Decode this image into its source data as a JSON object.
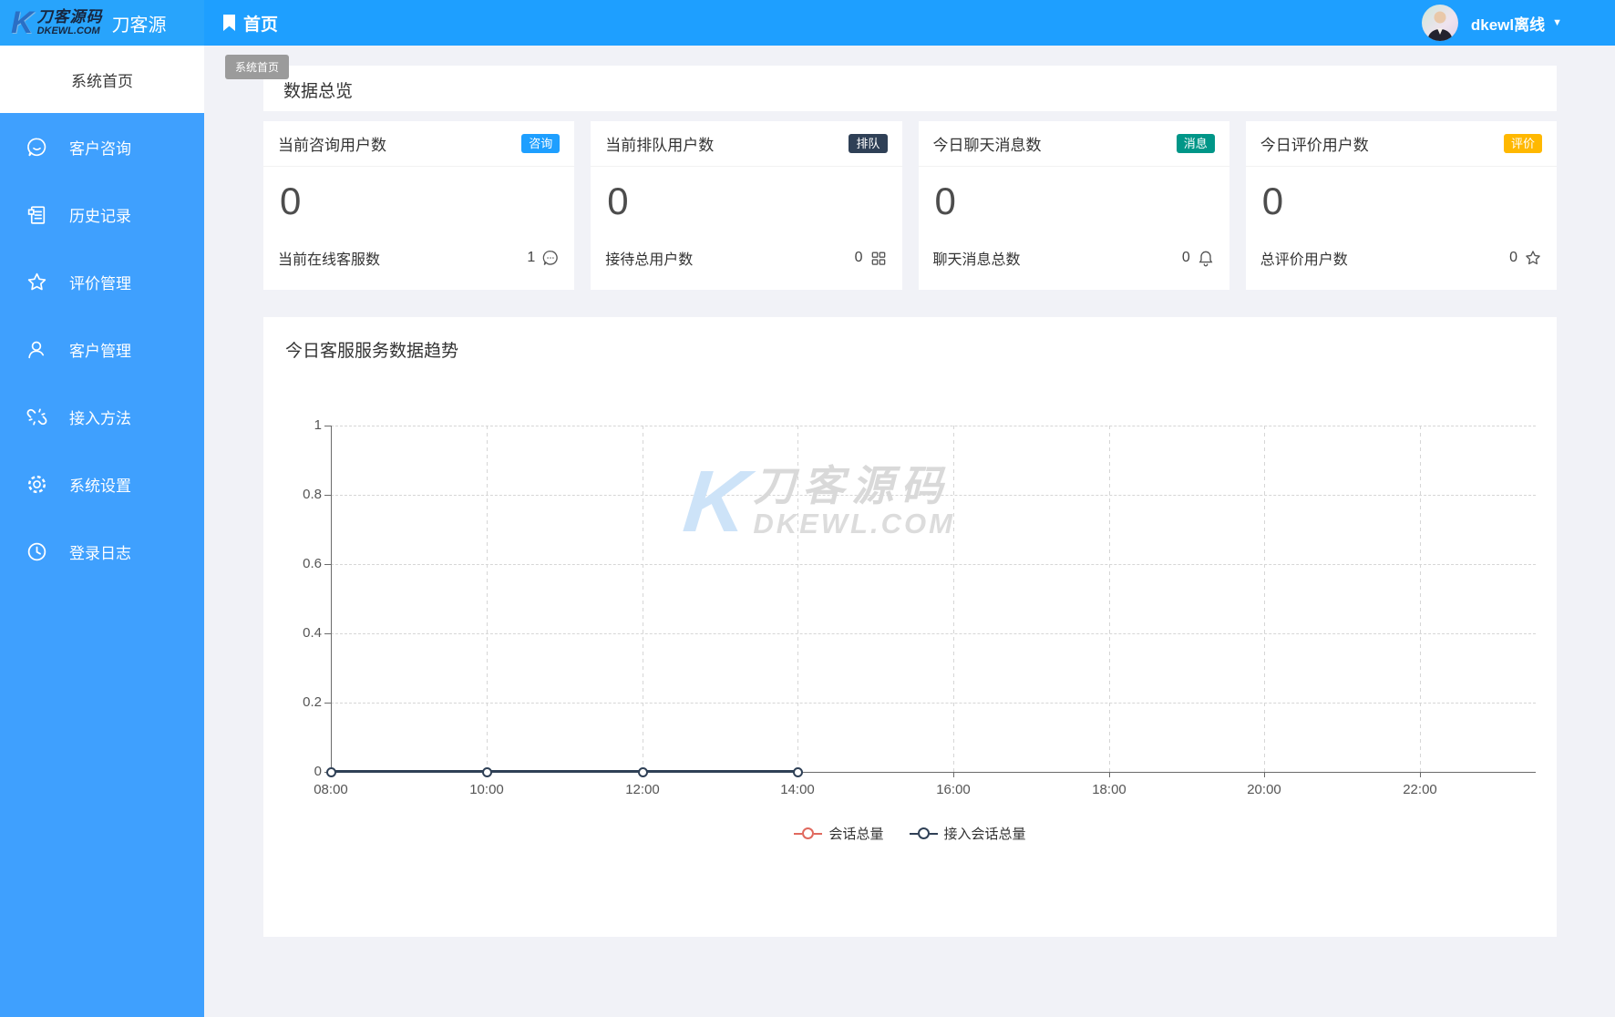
{
  "header": {
    "logo": {
      "k_glyph": "K",
      "brand_cn": "刀客源码",
      "brand_domain": "DKEWL.COM",
      "site_name": "刀客源"
    },
    "nav_home_label": "首页",
    "user": {
      "name_status": "dkewl离线",
      "caret": "▼"
    }
  },
  "tooltip_text": "系统首页",
  "sidebar": {
    "active_item": "系统首页",
    "items": [
      {
        "label": "客户咨询",
        "icon": "chat-smile-icon"
      },
      {
        "label": "历史记录",
        "icon": "history-record-icon"
      },
      {
        "label": "评价管理",
        "icon": "star-icon"
      },
      {
        "label": "客户管理",
        "icon": "user-icon"
      },
      {
        "label": "接入方法",
        "icon": "broken-link-icon"
      },
      {
        "label": "系统设置",
        "icon": "gear-icon"
      },
      {
        "label": "登录日志",
        "icon": "clock-icon"
      }
    ]
  },
  "overview": {
    "title": "数据总览"
  },
  "stat_cards": [
    {
      "title": "当前咨询用户数",
      "badge": "咨询",
      "badge_color": "#1e9fff",
      "value": "0",
      "sub_label": "当前在线客服数",
      "sub_value": "1",
      "sub_icon": "chat-smile-icon"
    },
    {
      "title": "当前排队用户数",
      "badge": "排队",
      "badge_color": "#2f4056",
      "value": "0",
      "sub_label": "接待总用户数",
      "sub_value": "0",
      "sub_icon": "reception-grid-icon"
    },
    {
      "title": "今日聊天消息数",
      "badge": "消息",
      "badge_color": "#009688",
      "value": "0",
      "sub_label": "聊天消息总数",
      "sub_value": "0",
      "sub_icon": "bell-icon"
    },
    {
      "title": "今日评价用户数",
      "badge": "评价",
      "badge_color": "#ffb800",
      "value": "0",
      "sub_label": "总评价用户数",
      "sub_value": "0",
      "sub_icon": "star-icon"
    }
  ],
  "chart_card": {
    "title": "今日客服服务数据趋势"
  },
  "chart_data": {
    "type": "line",
    "x": [
      "08:00",
      "10:00",
      "12:00",
      "14:00",
      "16:00",
      "18:00",
      "20:00",
      "22:00"
    ],
    "series": [
      {
        "name": "会话总量",
        "color": "#e0695e",
        "values": [
          0,
          0,
          0,
          0,
          null,
          null,
          null,
          null
        ]
      },
      {
        "name": "接入会话总量",
        "color": "#2f4056",
        "values": [
          0,
          0,
          0,
          0,
          null,
          null,
          null,
          null
        ]
      }
    ],
    "ylim": [
      0,
      1
    ],
    "ytick_labels": [
      "1",
      "0.8",
      "0.6",
      "0.4",
      "0.2",
      "0"
    ],
    "grid": true,
    "legend_position": "bottom",
    "watermark": {
      "k_glyph": "K",
      "cn": "刀客源码",
      "en": "DKEWL.COM"
    }
  }
}
